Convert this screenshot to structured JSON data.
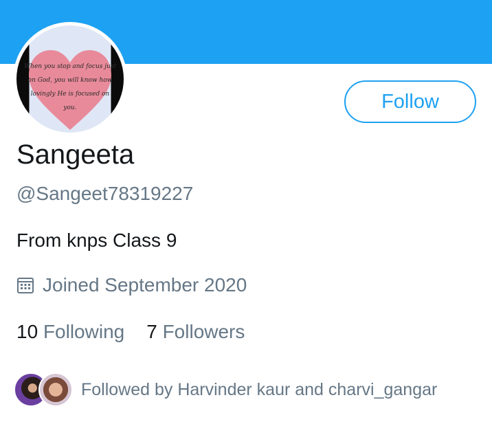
{
  "profile": {
    "avatar_quote": [
      "When you stop and focus just",
      "on God, you will know how",
      "lovingly He is focused on",
      "you."
    ],
    "follow_label": "Follow",
    "name": "Sangeeta",
    "handle": "@Sangeet78319227",
    "bio": "From knps Class 9",
    "joined": "Joined September 2020",
    "following_count": "10",
    "following_label": "Following",
    "followers_count": "7",
    "followers_label": "Followers",
    "followed_by": "Followed by Harvinder kaur and charvi_gangar"
  },
  "colors": {
    "accent": "#1da1f2",
    "secondary_text": "#657786",
    "primary_text": "#14171a"
  },
  "icons": [
    "calendar-icon"
  ]
}
